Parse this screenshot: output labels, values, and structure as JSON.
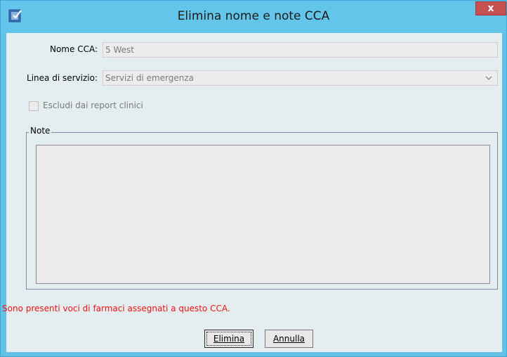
{
  "window": {
    "title": "Elimina nome e note CCA",
    "close_label": "x"
  },
  "form": {
    "cca_name_label": "Nome CCA:",
    "cca_name_value": "5 West",
    "service_line_label": "Linea di servizio:",
    "service_line_value": "Servizi di emergenza",
    "exclude_label": "Escludi dai report clinici",
    "exclude_checked": false
  },
  "notes": {
    "legend": "Note",
    "value": ""
  },
  "warning_text": "Sono presenti voci di farmaci assegnati a questo CCA.",
  "buttons": {
    "delete_label": "Elimina",
    "cancel_label": "Annulla"
  },
  "colors": {
    "titlebar": "#63c5ea",
    "warning": "#ee1111",
    "close": "#c75050"
  }
}
